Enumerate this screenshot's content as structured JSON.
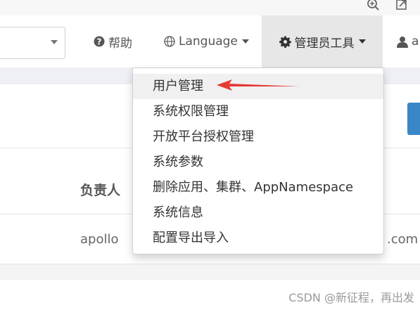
{
  "navbar": {
    "help_label": "帮助",
    "language_label": "Language",
    "admin_tools_label": "管理员工具",
    "user_label": "a"
  },
  "admin_menu": {
    "items": [
      {
        "label": "用户管理"
      },
      {
        "label": "系统权限管理"
      },
      {
        "label": "开放平台授权管理"
      },
      {
        "label": "系统参数"
      },
      {
        "label": "删除应用、集群、AppNamespace"
      },
      {
        "label": "系统信息"
      },
      {
        "label": "配置导出导入"
      }
    ]
  },
  "table": {
    "owner_header": "负责人",
    "row": {
      "owner": "apollo",
      "email_suffix": ".com"
    }
  },
  "watermark": "CSDN @新征程，再出发",
  "colors": {
    "accent_blue": "#3a87c7",
    "arrow_red": "#e53935"
  }
}
